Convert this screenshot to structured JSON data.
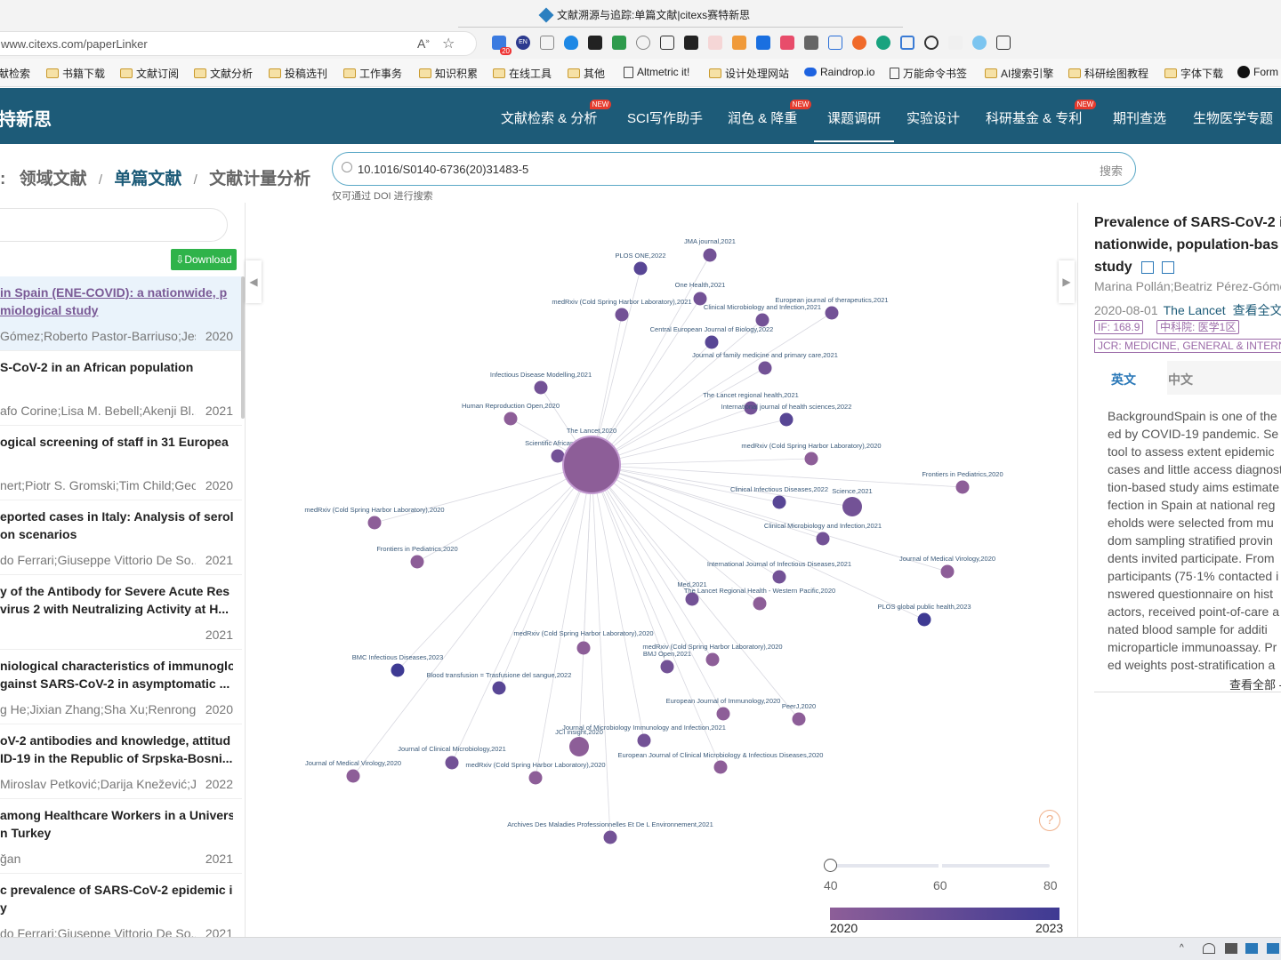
{
  "browser": {
    "tab_title": "文献溯源与追踪:单篇文献|citexs赛特新思",
    "url_prefix": "www.citexs.com/",
    "url_path": "paperLinker",
    "ext_badge": "20",
    "ext_en": "EN",
    "bookmarks": [
      {
        "label": "献检索",
        "type": "folder"
      },
      {
        "label": "书籍下载",
        "type": "folder"
      },
      {
        "label": "文献订阅",
        "type": "folder"
      },
      {
        "label": "文献分析",
        "type": "folder"
      },
      {
        "label": "投稿选刊",
        "type": "folder"
      },
      {
        "label": "工作事务",
        "type": "folder"
      },
      {
        "label": "知识积累",
        "type": "folder"
      },
      {
        "label": "在线工具",
        "type": "folder"
      },
      {
        "label": "其他",
        "type": "folder"
      },
      {
        "label": "Altmetric it!",
        "type": "doc"
      },
      {
        "label": "设计处理网站",
        "type": "folder"
      },
      {
        "label": "Raindrop.io",
        "type": "cloud"
      },
      {
        "label": "万能命令书签",
        "type": "doc"
      },
      {
        "label": "AI搜索引擎",
        "type": "folder"
      },
      {
        "label": "科研绘图教程",
        "type": "folder"
      },
      {
        "label": "字体下载",
        "type": "folder"
      },
      {
        "label": "Form",
        "type": "site"
      }
    ]
  },
  "site": {
    "logo": "持新思",
    "nav": [
      {
        "label": "文献检索 & 分析",
        "new": true
      },
      {
        "label": "SCI写作助手",
        "new": false
      },
      {
        "label": "润色 & 降重",
        "new": true
      },
      {
        "label": "课题调研",
        "new": false
      },
      {
        "label": "实验设计",
        "new": false
      },
      {
        "label": "科研基金 & 专利",
        "new": true
      },
      {
        "label": "期刊查选",
        "new": false
      },
      {
        "label": "生物医学专题",
        "new": false
      }
    ],
    "new_badge": "NEW"
  },
  "breadcrumb": {
    "lead": ":",
    "items": [
      "领域文献",
      "单篇文献",
      "文献计量分析"
    ],
    "sep": "/"
  },
  "search": {
    "value": "10.1016/S0140-6736(20)31483-5",
    "button": "搜索",
    "hint": "仅可通过 DOI 进行搜索"
  },
  "left": {
    "download": "⇩Download",
    "papers": [
      {
        "title1": "in Spain (ENE-COVID): a nationwide, p",
        "title2": "miological study",
        "authors": "Gómez;Roberto Pastor-Barriuso;Jes...",
        "year": "2020",
        "selected": true
      },
      {
        "title1": "S-CoV-2 in an African population",
        "title2": "",
        "authors": "afo Corine;Lisa M. Bebell;Akenji Bl...",
        "year": "2021"
      },
      {
        "title1": "ogical screening of staff in 31 Europea",
        "title2": "",
        "authors": "nert;Piotr S. Gromski;Tim Child;Geo...",
        "year": "2020"
      },
      {
        "title1": "eported cases in Italy: Analysis of serol",
        "title2": "on scenarios",
        "authors": "do Ferrari;Giuseppe Vittorio De So...",
        "year": "2021"
      },
      {
        "title1": "y of the Antibody for Severe Acute Res",
        "title2": "virus 2 with Neutralizing Activity at H...",
        "authors": "",
        "year": "2021"
      },
      {
        "title1": "niological characteristics of immunoglo",
        "title2": "gainst SARS-CoV-2 in asymptomatic ...",
        "authors": "g He;Jixian Zhang;Sha Xu;Renrong...",
        "year": "2020"
      },
      {
        "title1": "oV-2 antibodies and knowledge, attitud",
        "title2": "ID-19 in the Republic of Srpska-Bosni...",
        "authors": "Miroslav Petković;Darija Knežević;J...",
        "year": "2022"
      },
      {
        "title1": "among Healthcare Workers in a Univers",
        "title2": "n Turkey",
        "authors": "ğan",
        "year": "2021"
      },
      {
        "title1": "c prevalence of SARS-CoV-2 epidemic i",
        "title2": "y",
        "authors": "do Ferrari;Giuseppe Vittorio De So...",
        "year": "2021"
      }
    ]
  },
  "graph": {
    "center": {
      "label": "The Lancet,2020",
      "year": 2020,
      "size": 80
    },
    "nodes": [
      {
        "label": "JMA journal,2021",
        "year": 2021
      },
      {
        "label": "PLOS ONE,2022",
        "year": 2022
      },
      {
        "label": "One Health,2021",
        "year": 2021
      },
      {
        "label": "medRxiv (Cold Spring Harbor Laboratory),2021",
        "year": 2021
      },
      {
        "label": "Clinical Microbiology and Infection,2021",
        "year": 2021
      },
      {
        "label": "European journal of therapeutics,2021",
        "year": 2021
      },
      {
        "label": "Central European Journal of Biology,2022",
        "year": 2022
      },
      {
        "label": "Journal of family medicine and primary care,2021",
        "year": 2021
      },
      {
        "label": "Infectious Disease Modelling,2021",
        "year": 2021
      },
      {
        "label": "The Lancet regional health,2021",
        "year": 2021
      },
      {
        "label": "International journal of health sciences,2022",
        "year": 2022
      },
      {
        "label": "Human Reproduction Open,2020",
        "year": 2020
      },
      {
        "label": "Scientific African,2021",
        "year": 2021
      },
      {
        "label": "medRxiv (Cold Spring Harbor Laboratory),2020",
        "year": 2020
      },
      {
        "label": "Frontiers in Pediatrics,2020",
        "year": 2020
      },
      {
        "label": "Clinical Infectious Diseases,2022",
        "year": 2022
      },
      {
        "label": "Science,2021",
        "year": 2021
      },
      {
        "label": "medRxiv (Cold Spring Harbor Laboratory),2020",
        "year": 2020
      },
      {
        "label": "Clinical Microbiology and Infection,2021",
        "year": 2021
      },
      {
        "label": "Frontiers in Pediatrics,2020",
        "year": 2020
      },
      {
        "label": "Journal of Medical Virology,2020",
        "year": 2020
      },
      {
        "label": "International Journal of Infectious Diseases,2021",
        "year": 2021
      },
      {
        "label": "Med,2021",
        "year": 2021
      },
      {
        "label": "The Lancet Regional Health - Western Pacific,2020",
        "year": 2020
      },
      {
        "label": "PLOS global public health,2023",
        "year": 2023
      },
      {
        "label": "medRxiv (Cold Spring Harbor Laboratory),2020",
        "year": 2020
      },
      {
        "label": "BMJ Open,2021",
        "year": 2021
      },
      {
        "label": "medRxiv (Cold Spring Harbor Laboratory),2020",
        "year": 2020
      },
      {
        "label": "BMC Infectious Diseases,2023",
        "year": 2023
      },
      {
        "label": "Blood transfusion = Trasfusione del sangue,2022",
        "year": 2022
      },
      {
        "label": "European Journal of Immunology,2020",
        "year": 2020
      },
      {
        "label": "PeerJ,2020",
        "year": 2020
      },
      {
        "label": "JCI insight,2020",
        "year": 2020
      },
      {
        "label": "Journal of Microbiology Immunology and Infection,2021",
        "year": 2021
      },
      {
        "label": "Journal of Clinical Microbiology,2021",
        "year": 2021
      },
      {
        "label": "European Journal of Clinical Microbiology & Infectious Diseases,2020",
        "year": 2020
      },
      {
        "label": "Journal of Medical Virology,2020",
        "year": 2020
      },
      {
        "label": "medRxiv (Cold Spring Harbor Laboratory),2020",
        "year": 2020
      },
      {
        "label": "Archives Des Maladies Professionnelles Et De L Environnement,2021",
        "year": 2021
      }
    ],
    "slider": {
      "min": 40,
      "mid": 60,
      "max": 80,
      "value": 40
    },
    "colorbar": {
      "min": "2020",
      "max": "2023",
      "from": "#8d5e98",
      "to": "#3e3a93"
    }
  },
  "right": {
    "title_lines": [
      "Prevalence of SARS-CoV-2 i",
      "nationwide, population-bas",
      "study"
    ],
    "authors": "Marina Pollán;Beatriz Pérez-Góme",
    "date": "2020-08-01",
    "journal": "The Lancet",
    "fulltext": "查看全文",
    "if": "IF:  168.9",
    "cas": "中科院:  医学1区",
    "jcr": "JCR:  MEDICINE,  GENERAL & INTERN",
    "tabs": [
      "英文",
      "中文"
    ],
    "abstract_lines": [
      "BackgroundSpain is one of the",
      "ed by COVID-19 pandemic. Se",
      "tool to assess extent epidemic",
      "cases and little access diagnost",
      "tion-based study aims estimate",
      "fection in Spain at national reg",
      "eholds were selected from mu",
      "dom sampling stratified provin",
      "dents invited participate. From",
      "participants (75·1% contacted i",
      "nswered questionnaire on hist",
      "actors, received point-of-care a",
      "nated blood sample for additi",
      "microparticle immunoassay. Pr",
      "ed weights post-stratification a"
    ],
    "more": "查看全部 -"
  }
}
